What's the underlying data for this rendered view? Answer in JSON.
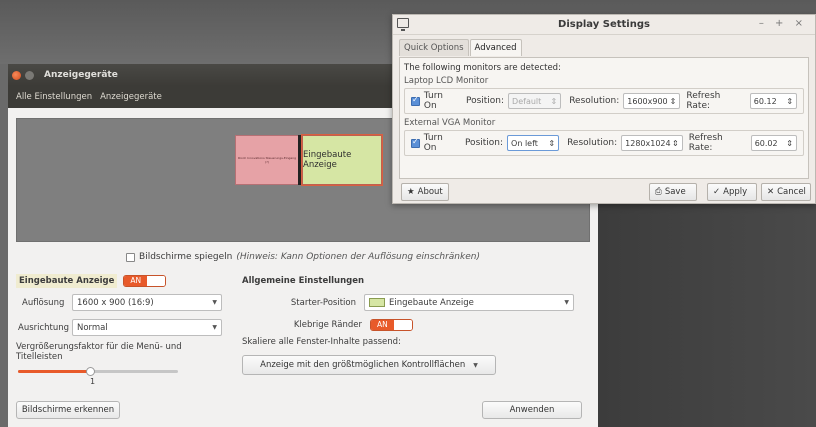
{
  "main_window": {
    "title": "Anzeigegeräte",
    "menu": [
      "Alle Einstellungen",
      "Anzeigegeräte"
    ],
    "monitors": {
      "external_label": "Ricoh Innovations Steuerungs-Eingang (?)",
      "internal_label": "Eingebaute Anzeige"
    },
    "mirror": {
      "label": "Bildschirme spiegeln",
      "hint": "(Hinweis: Kann Optionen der Auflösung einschränken)"
    },
    "builtin": {
      "header": "Eingebaute Anzeige",
      "toggle": "AN",
      "resolution_label": "Auflösung",
      "resolution_value": "1600 x 900 (16:9)",
      "orientation_label": "Ausrichtung",
      "orientation_value": "Normal",
      "scale_label": "Vergrößerungsfaktor für die Menü- und Titelleisten",
      "scale_value": "1"
    },
    "general": {
      "header": "Allgemeine Einstellungen",
      "launcher_label": "Starter-Position",
      "launcher_value": "Eingebaute Anzeige",
      "sticky_label": "Klebrige Ränder",
      "sticky_toggle": "AN",
      "scale_all_label": "Skaliere alle Fenster-Inhalte passend:",
      "scale_all_value": "Anzeige mit den größtmöglichen Kontrollflächen"
    },
    "buttons": {
      "detect": "Bildschirme erkennen",
      "apply": "Anwenden"
    }
  },
  "display_settings": {
    "title": "Display Settings",
    "window_controls": "– + ×",
    "tabs": [
      "Quick Options",
      "Advanced"
    ],
    "detected_text": "The following monitors are detected:",
    "laptop": {
      "group": "Laptop LCD Monitor",
      "turn_on": "Turn On",
      "position_label": "Position:",
      "position_value": "Default",
      "resolution_label": "Resolution:",
      "resolution_value": "1600x900",
      "refresh_label": "Refresh Rate:",
      "refresh_value": "60.12"
    },
    "vga": {
      "group": "External VGA Monitor",
      "turn_on": "Turn On",
      "position_label": "Position:",
      "position_value": "On left",
      "resolution_label": "Resolution:",
      "resolution_value": "1280x1024",
      "refresh_label": "Refresh Rate:",
      "refresh_value": "60.02"
    },
    "buttons": {
      "about": "About",
      "save": "Save",
      "apply": "Apply",
      "cancel": "Cancel"
    }
  },
  "colors": {
    "accent": "#e85a2a",
    "monitor_external": "#e6a2a6",
    "monitor_internal": "#d6e6a4",
    "checkbox_blue": "#5a8fd6"
  }
}
